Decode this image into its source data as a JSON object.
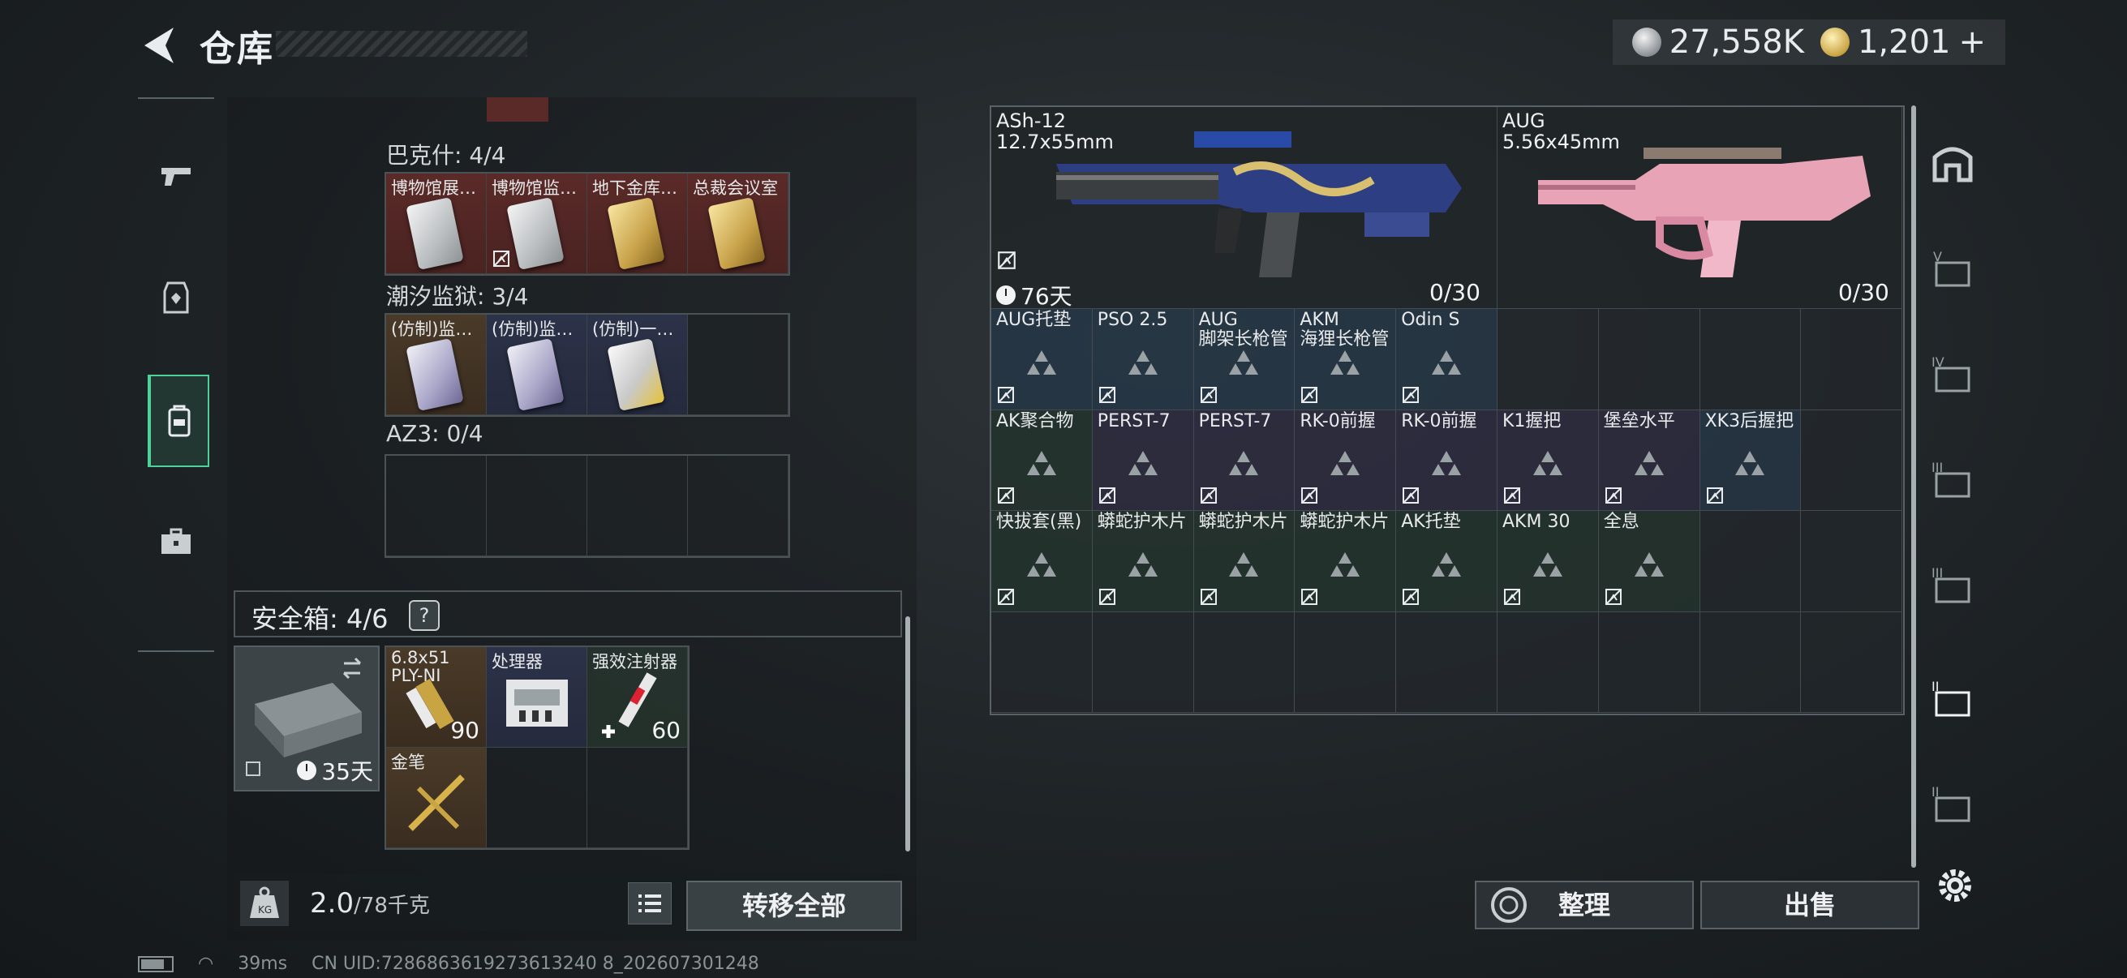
{
  "header": {
    "title": "仓库"
  },
  "currency": {
    "silver_value": "27,558K",
    "gold_value": "1,201",
    "gold_add": "+"
  },
  "left_nav": [
    "pistol-icon",
    "armor-icon",
    "backpack-icon",
    "toolbox-icon"
  ],
  "key_sections": [
    {
      "title": "巴克什: 4/4",
      "cells": [
        {
          "label": "博物馆展…",
          "color": "red",
          "card": "silver",
          "nobind": false
        },
        {
          "label": "博物馆监…",
          "color": "red",
          "card": "silver",
          "nobind": true
        },
        {
          "label": "地下金库…",
          "color": "red",
          "card": "gold",
          "nobind": false
        },
        {
          "label": "总裁会议室",
          "color": "red",
          "card": "gold",
          "nobind": false
        }
      ]
    },
    {
      "title": "潮汐监狱: 3/4",
      "cells": [
        {
          "label": "(仿制)监…",
          "color": "brown",
          "card": "purple",
          "nobind": false
        },
        {
          "label": "(仿制)监…",
          "color": "blue",
          "card": "purple",
          "nobind": false
        },
        {
          "label": "(仿制)一…",
          "color": "blue",
          "card": "yellow",
          "nobind": false
        },
        {
          "label": "",
          "color": "empty",
          "card": "",
          "nobind": false
        }
      ]
    },
    {
      "title": "AZ3: 0/4",
      "cells": [
        {
          "label": "",
          "color": "empty"
        },
        {
          "label": "",
          "color": "empty"
        },
        {
          "label": "",
          "color": "empty"
        },
        {
          "label": "",
          "color": "empty"
        }
      ]
    }
  ],
  "safebox": {
    "label": "安全箱:  4/6",
    "help": "?",
    "timer": "35天"
  },
  "secure_items": [
    {
      "label": "6.8x51\nPLY-NI",
      "qty": "90"
    },
    {
      "label": "处理器",
      "qty": ""
    },
    {
      "label": "强效注射器",
      "qty": "60"
    },
    {
      "label": "金笔",
      "qty": ""
    },
    {
      "label": "",
      "qty": ""
    },
    {
      "label": "",
      "qty": ""
    }
  ],
  "weight": {
    "value": "2.0",
    "unit": "/78千克"
  },
  "transfer_all": "转移全部",
  "weapons": [
    {
      "name": "ASh-12",
      "caliber": "12.7x55mm",
      "timer": "76天",
      "ammo": "0/30"
    },
    {
      "name": "AUG",
      "caliber": "5.56x45mm",
      "ammo": "0/30"
    }
  ],
  "stash_rows": [
    [
      {
        "label": "AUG托垫",
        "color": "blue"
      },
      {
        "label": "PSO 2.5",
        "color": "blue"
      },
      {
        "label": "AUG\n脚架长枪管",
        "color": "blue"
      },
      {
        "label": "AKM\n海狸长枪管",
        "color": "blue"
      },
      {
        "label": "Odin S",
        "color": "blue"
      }
    ],
    [
      {
        "label": "AK聚合物",
        "color": "green"
      },
      {
        "label": "PERST-7",
        "color": "purple"
      },
      {
        "label": "PERST-7",
        "color": "purple"
      },
      {
        "label": "RK-0前握",
        "color": "purple"
      },
      {
        "label": "RK-0前握",
        "color": "purple"
      },
      {
        "label": "K1握把",
        "color": "purple"
      },
      {
        "label": "堡垒水平",
        "color": "purple"
      },
      {
        "label": "XK3后握把",
        "color": "blue"
      }
    ],
    [
      {
        "label": "快拔套(黑)",
        "color": "green"
      },
      {
        "label": "蟒蛇护木片",
        "color": "green"
      },
      {
        "label": "蟒蛇护木片",
        "color": "green"
      },
      {
        "label": "蟒蛇护木片",
        "color": "green"
      },
      {
        "label": "AK托垫",
        "color": "green"
      },
      {
        "label": "AKM 30",
        "color": "green"
      },
      {
        "label": "全息",
        "color": "green"
      }
    ]
  ],
  "buttons": {
    "sort": "整理",
    "sell": "出售"
  },
  "footer": {
    "ping": "39ms",
    "uid": "CN UID:7286863619273613240 8_202607301248"
  }
}
